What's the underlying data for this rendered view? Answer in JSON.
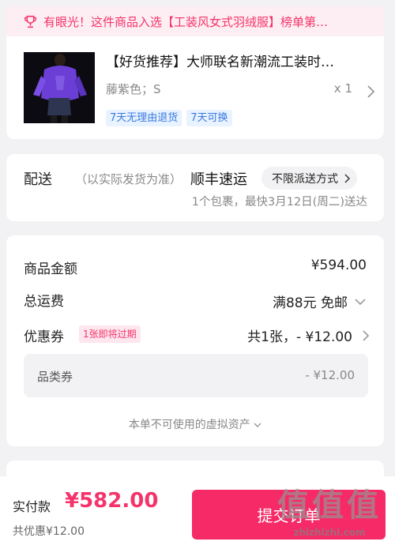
{
  "banner": {
    "text": "有眼光！这件商品入选【工装风女式羽绒服】榜单第…"
  },
  "product": {
    "title": "【好货推荐】大师联名新潮流工装时…",
    "sku": "藤紫色；S",
    "qty": "x 1",
    "tags": [
      "7天无理由退货",
      "7天可换"
    ]
  },
  "shipping": {
    "label": "配送",
    "note": "（以实际发货为准）",
    "carrier": "顺丰速运",
    "method": "不限派送方式",
    "eta": "1个包裹，最快3月12日(周二)送达"
  },
  "price": {
    "goods_label": "商品金额",
    "goods_value": "¥594.00",
    "freight_label": "总运费",
    "freight_value": "满88元 免邮",
    "coupon_label": "优惠券",
    "coupon_badge": "1张即将过期",
    "coupon_value": "共1张，- ¥12.00",
    "category_coupon_label": "品类券",
    "category_coupon_value": "- ¥12.00",
    "virtual_assets": "本单不可使用的虚拟资产"
  },
  "footer": {
    "pay_label": "实付款",
    "pay_amount": "¥582.00",
    "discount": "共优惠¥12.00",
    "submit": "提交订单"
  },
  "watermark": {
    "logo": "值值值",
    "url": "zhizhizhi.com"
  },
  "colors": {
    "accent": "#f5336b",
    "button": "#f52a66",
    "tag_blue": "#3a7ae0",
    "banner_bg": "#fdeef3"
  }
}
